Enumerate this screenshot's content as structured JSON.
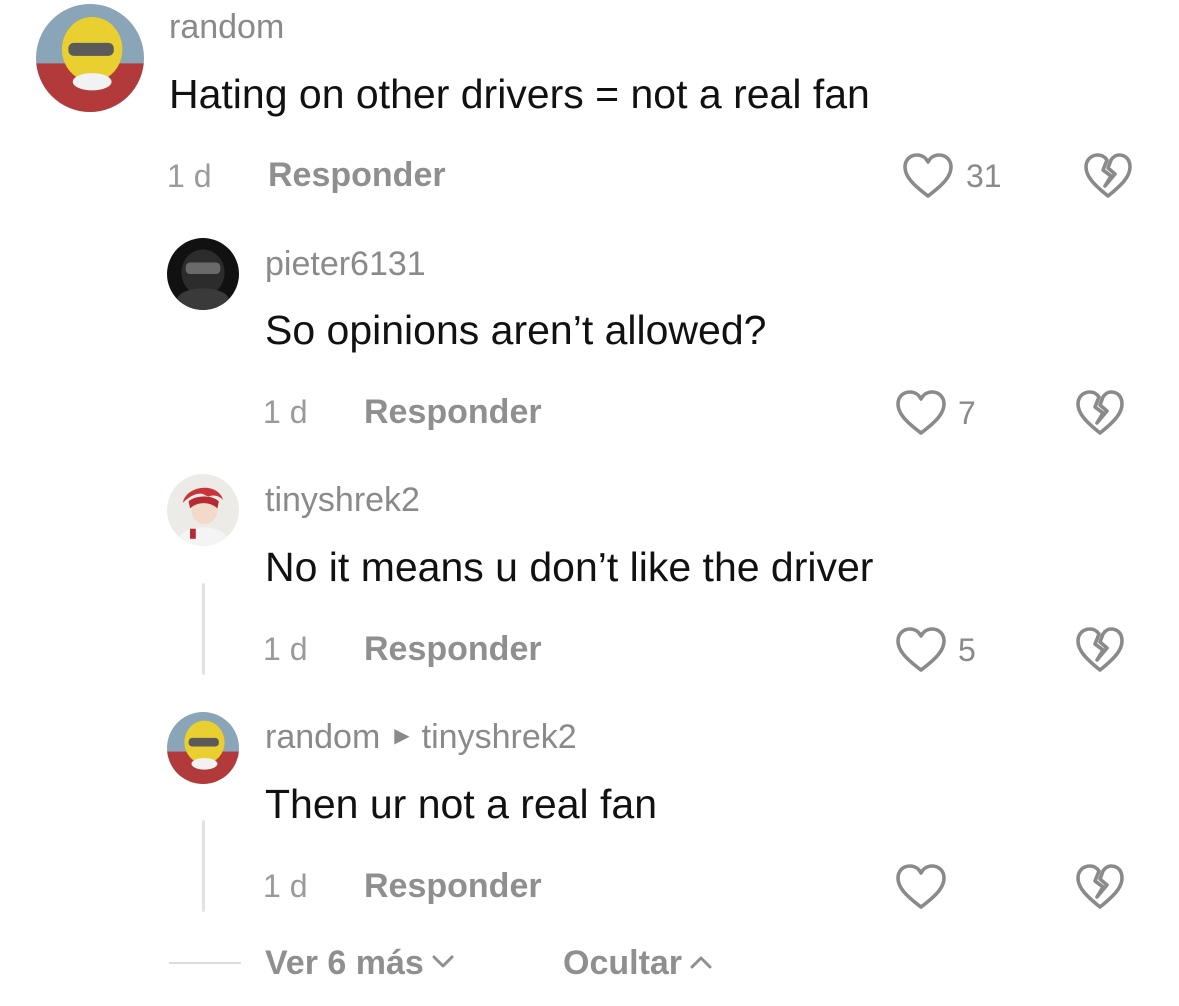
{
  "comments": [
    {
      "username": "random",
      "text": "Hating on other drivers = not a real fan",
      "time": "1 d",
      "reply_label": "Responder",
      "likes": "31"
    },
    {
      "username": "pieter6131",
      "text": "So opinions aren’t allowed?",
      "time": "1 d",
      "reply_label": "Responder",
      "likes": "7"
    },
    {
      "username": "tinyshrek2",
      "text": "No it means u don’t like the driver",
      "time": "1 d",
      "reply_label": "Responder",
      "likes": "5"
    },
    {
      "username": "random",
      "reply_to": "tinyshrek2",
      "text": "Then ur not a real fan",
      "time": "1 d",
      "reply_label": "Responder",
      "likes": ""
    }
  ],
  "footer": {
    "view_more": "Ver 6 más",
    "hide": "Ocultar"
  }
}
